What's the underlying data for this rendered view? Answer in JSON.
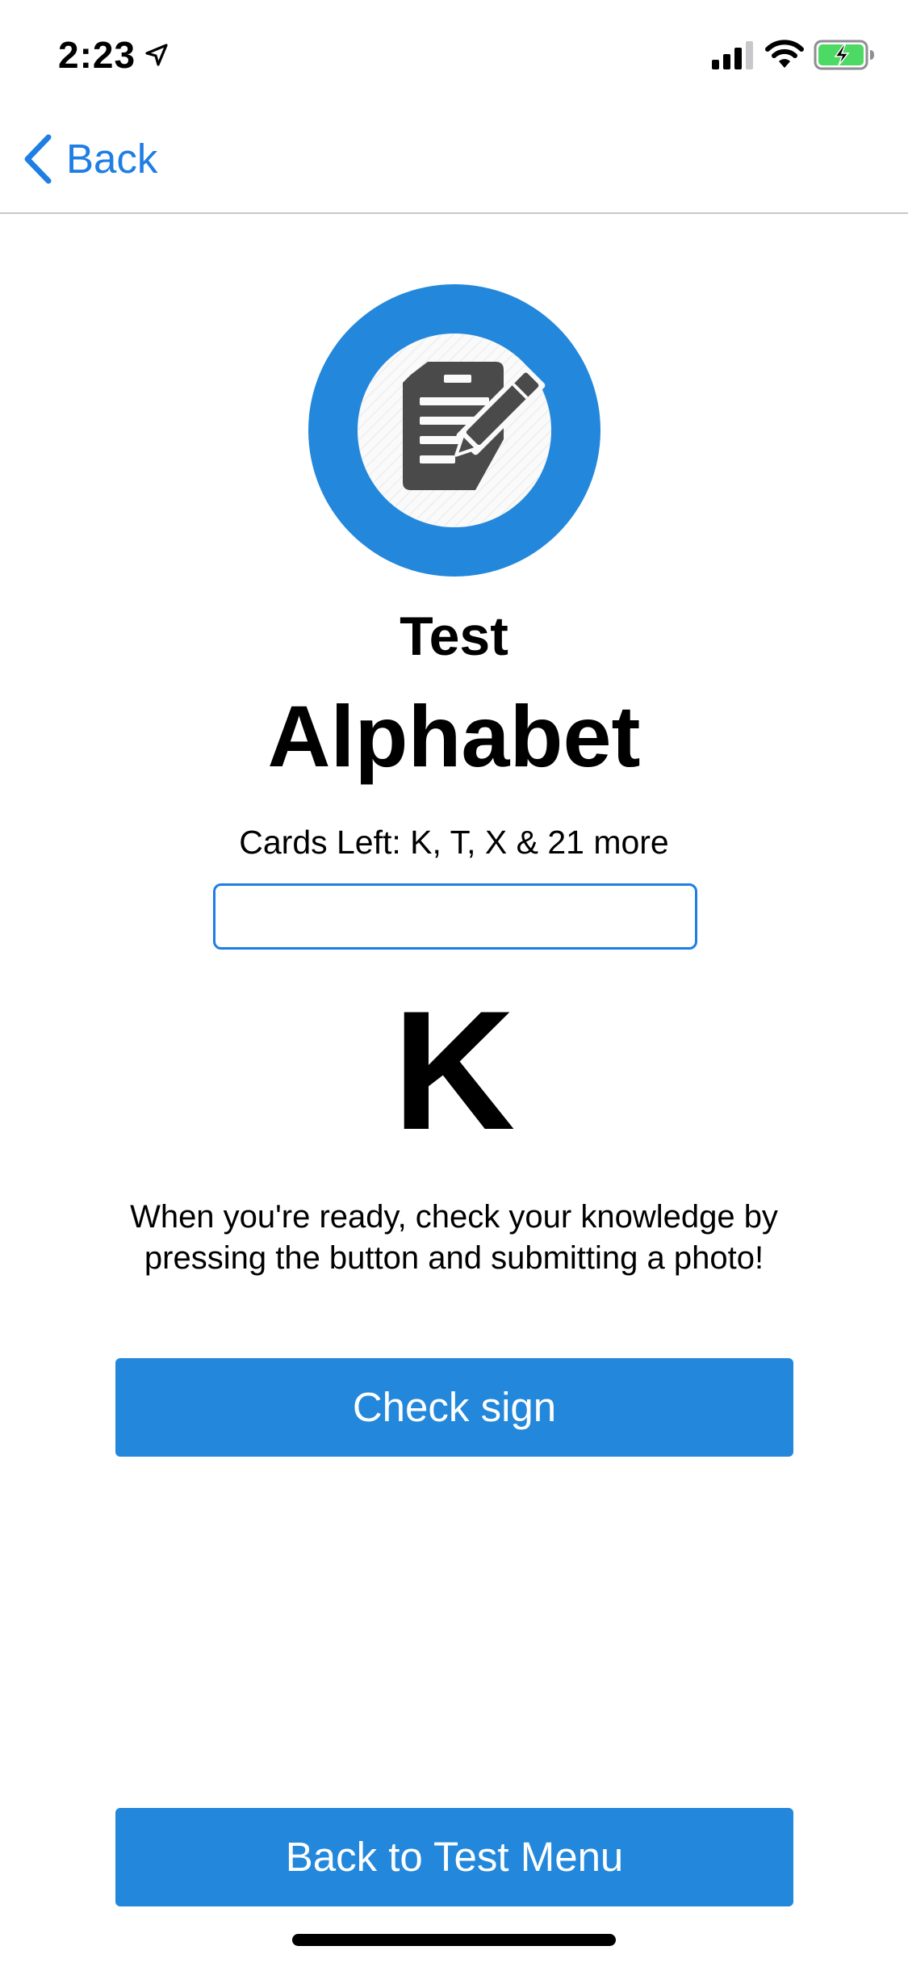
{
  "status_bar": {
    "time": "2:23",
    "icons": [
      "location-arrow-icon",
      "cellular-signal-icon",
      "wifi-icon",
      "battery-charging-icon"
    ],
    "battery_color": "#4cd964"
  },
  "nav": {
    "back_label": "Back",
    "back_icon": "chevron-left-icon"
  },
  "theme": {
    "accent": "#1e7ee4",
    "button": "#2388db",
    "logo_ring": "#2388db",
    "logo_icon": "#4a4a4a"
  },
  "main": {
    "logo_icon": "test-document-pencil-icon",
    "mode_label": "Test",
    "deck_title": "Alphabet",
    "cards_left": "Cards Left: K, T, X & 21 more",
    "progress_fraction": 0,
    "current_letter": "K",
    "instructions": "When you're ready, check your knowledge by pressing the button and submitting a photo!",
    "check_button": "Check sign",
    "back_menu_button": "Back to Test Menu"
  }
}
